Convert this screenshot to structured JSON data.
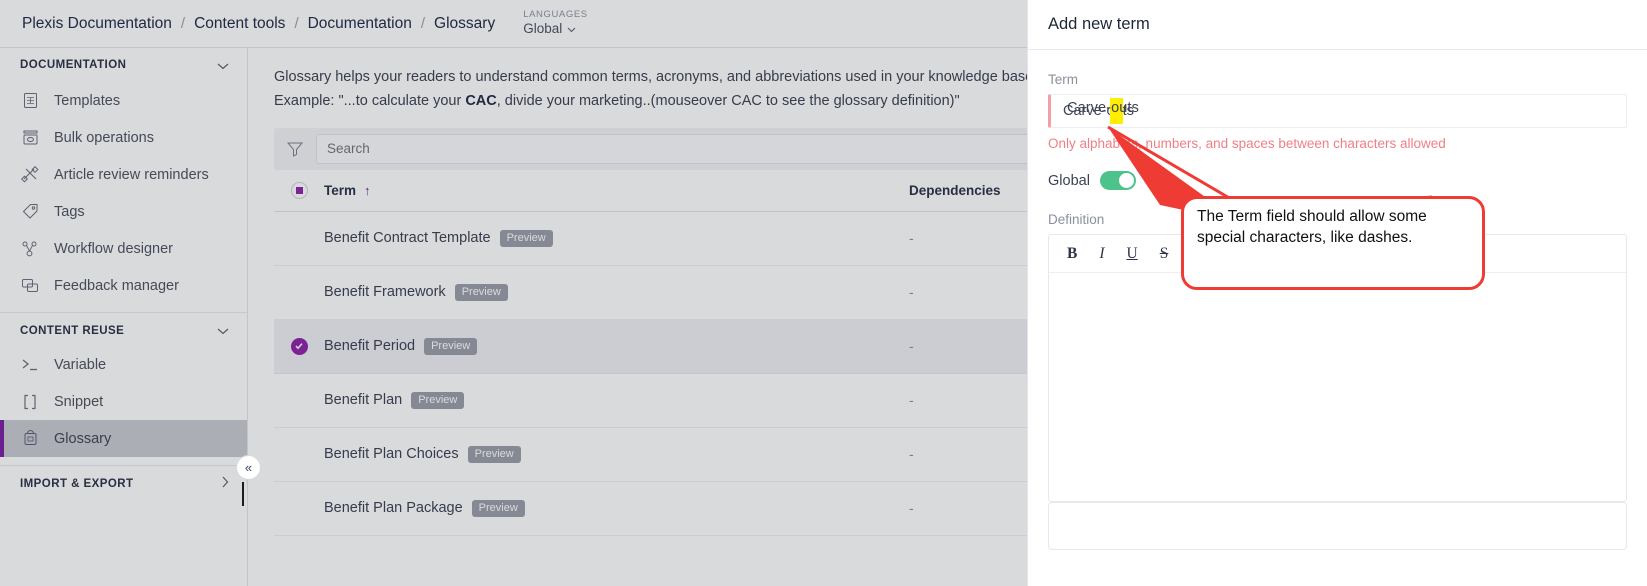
{
  "breadcrumb": {
    "items": [
      "Plexis Documentation",
      "Content tools",
      "Documentation",
      "Glossary"
    ],
    "separator": "/"
  },
  "languages": {
    "label": "LANGUAGES",
    "value": "Global",
    "caret": "⌄"
  },
  "sidebar": {
    "sections": [
      {
        "title": "DOCUMENTATION",
        "chevron": "⌄",
        "items": [
          {
            "label": "Templates",
            "icon": "templates-icon"
          },
          {
            "label": "Bulk operations",
            "icon": "bulk-operations-icon"
          },
          {
            "label": "Article review reminders",
            "icon": "article-review-icon"
          },
          {
            "label": "Tags",
            "icon": "tag-icon"
          },
          {
            "label": "Workflow designer",
            "icon": "workflow-icon"
          },
          {
            "label": "Feedback manager",
            "icon": "feedback-icon"
          }
        ]
      },
      {
        "title": "CONTENT REUSE",
        "chevron": "⌄",
        "items": [
          {
            "label": "Variable",
            "icon": "variable-icon"
          },
          {
            "label": "Snippet",
            "icon": "snippet-icon"
          },
          {
            "label": "Glossary",
            "icon": "glossary-icon",
            "active": true
          }
        ]
      },
      {
        "title": "IMPORT & EXPORT",
        "chevron": "›",
        "items": []
      }
    ],
    "collapse_button": "«",
    "accent_color": "#7b1fa2"
  },
  "main": {
    "intro_line1": "Glossary helps your readers to understand common terms, acronyms, and abbreviations used in your knowledge base.",
    "intro_line2_pre": "Example: \"...to calculate your ",
    "intro_line2_bold": "CAC",
    "intro_line2_post": ", divide your marketing..(mouseover CAC to see the glossary definition)\"",
    "search": {
      "placeholder": "Search",
      "value": "",
      "filter_icon": "funnel-icon"
    },
    "table": {
      "columns": [
        "Term",
        "Dependencies"
      ],
      "sort_indicator": "↑",
      "header_checkbox_state": "indeterminate",
      "rows": [
        {
          "term": "Benefit Contract Template",
          "badge": "Preview",
          "dependencies": "-",
          "selected": false
        },
        {
          "term": "Benefit Framework",
          "badge": "Preview",
          "dependencies": "-",
          "selected": false
        },
        {
          "term": "Benefit Period",
          "badge": "Preview",
          "dependencies": "-",
          "selected": true
        },
        {
          "term": "Benefit Plan",
          "badge": "Preview",
          "dependencies": "-",
          "selected": false
        },
        {
          "term": "Benefit Plan Choices",
          "badge": "Preview",
          "dependencies": "-",
          "selected": false
        },
        {
          "term": "Benefit Plan Package",
          "badge": "Preview",
          "dependencies": "-",
          "selected": false
        }
      ]
    }
  },
  "drawer": {
    "title": "Add new term",
    "term_field": {
      "label": "Term",
      "value": "Carve-outs",
      "value_prefix": "Carve",
      "value_highlight": "-",
      "value_suffix": "outs",
      "error": "Only alphabets, numbers, and spaces between characters allowed",
      "highlight_color": "#ffee00",
      "error_color": "#ef7f87"
    },
    "global": {
      "label": "Global",
      "enabled": true,
      "info_icon": "info-icon",
      "on_color": "#4cc38a"
    },
    "definition": {
      "label": "Definition",
      "toolbar": [
        {
          "label": "B",
          "name": "bold-button"
        },
        {
          "label": "I",
          "name": "italic-button"
        },
        {
          "label": "U",
          "name": "underline-button"
        },
        {
          "label": "S",
          "name": "strikethrough-button"
        }
      ],
      "content": ""
    }
  },
  "annotation": {
    "text": "The Term field should allow some special characters, like dashes.",
    "border_color": "#ee3b33",
    "arrow_color": "#ee3b33"
  }
}
